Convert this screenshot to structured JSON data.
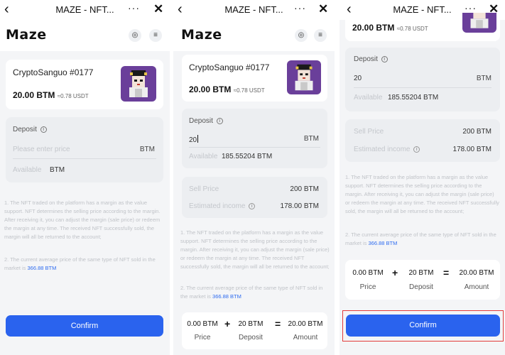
{
  "header": {
    "back_icon": "chevron-left-icon",
    "title": "MAZE - NFT...",
    "more_label": "···",
    "close_label": "✕"
  },
  "brand": {
    "name": "Maze"
  },
  "nft": {
    "name": "CryptoSanguo #0177",
    "price": "20.00 BTM",
    "price_usdt": "≈0.78 USDT",
    "price_usdt_short": "≈0.78 USDT"
  },
  "deposit": {
    "label": "Deposit",
    "placeholder": "Please enter price",
    "currency": "BTM",
    "available_label": "Available",
    "available_empty": "BTM",
    "available_value": "185.55204 BTM",
    "entered_value": "20"
  },
  "sell": {
    "sell_price_label": "Sell Price",
    "sell_price_value": "200 BTM",
    "income_label": "Estimated income",
    "income_value": "178.00 BTM"
  },
  "notes": {
    "note1": "1. The NFT traded on the platform has a margin as the value support. NFT determines the selling price according to the margin. After receiving it, you can adjust the margin (sale price) or redeem the margin at any time. The received NFT successfully sold, the margin will all be returned to the account;",
    "note2_prefix": "2. The current average price of the same type of NFT sold in the market is",
    "note2_value": "366.88 BTM"
  },
  "summary": {
    "price_value": "0.00 BTM",
    "price_label": "Price",
    "plus": "+",
    "deposit_value": "20 BTM",
    "deposit_label": "Deposit",
    "equals": "=",
    "amount_value": "20.00 BTM",
    "amount_label": "Amount"
  },
  "confirm_label": "Confirm",
  "colors": {
    "accent": "#2a63ee",
    "highlight": "#e23a3a",
    "avatar_bg": "#6a3f9a"
  }
}
